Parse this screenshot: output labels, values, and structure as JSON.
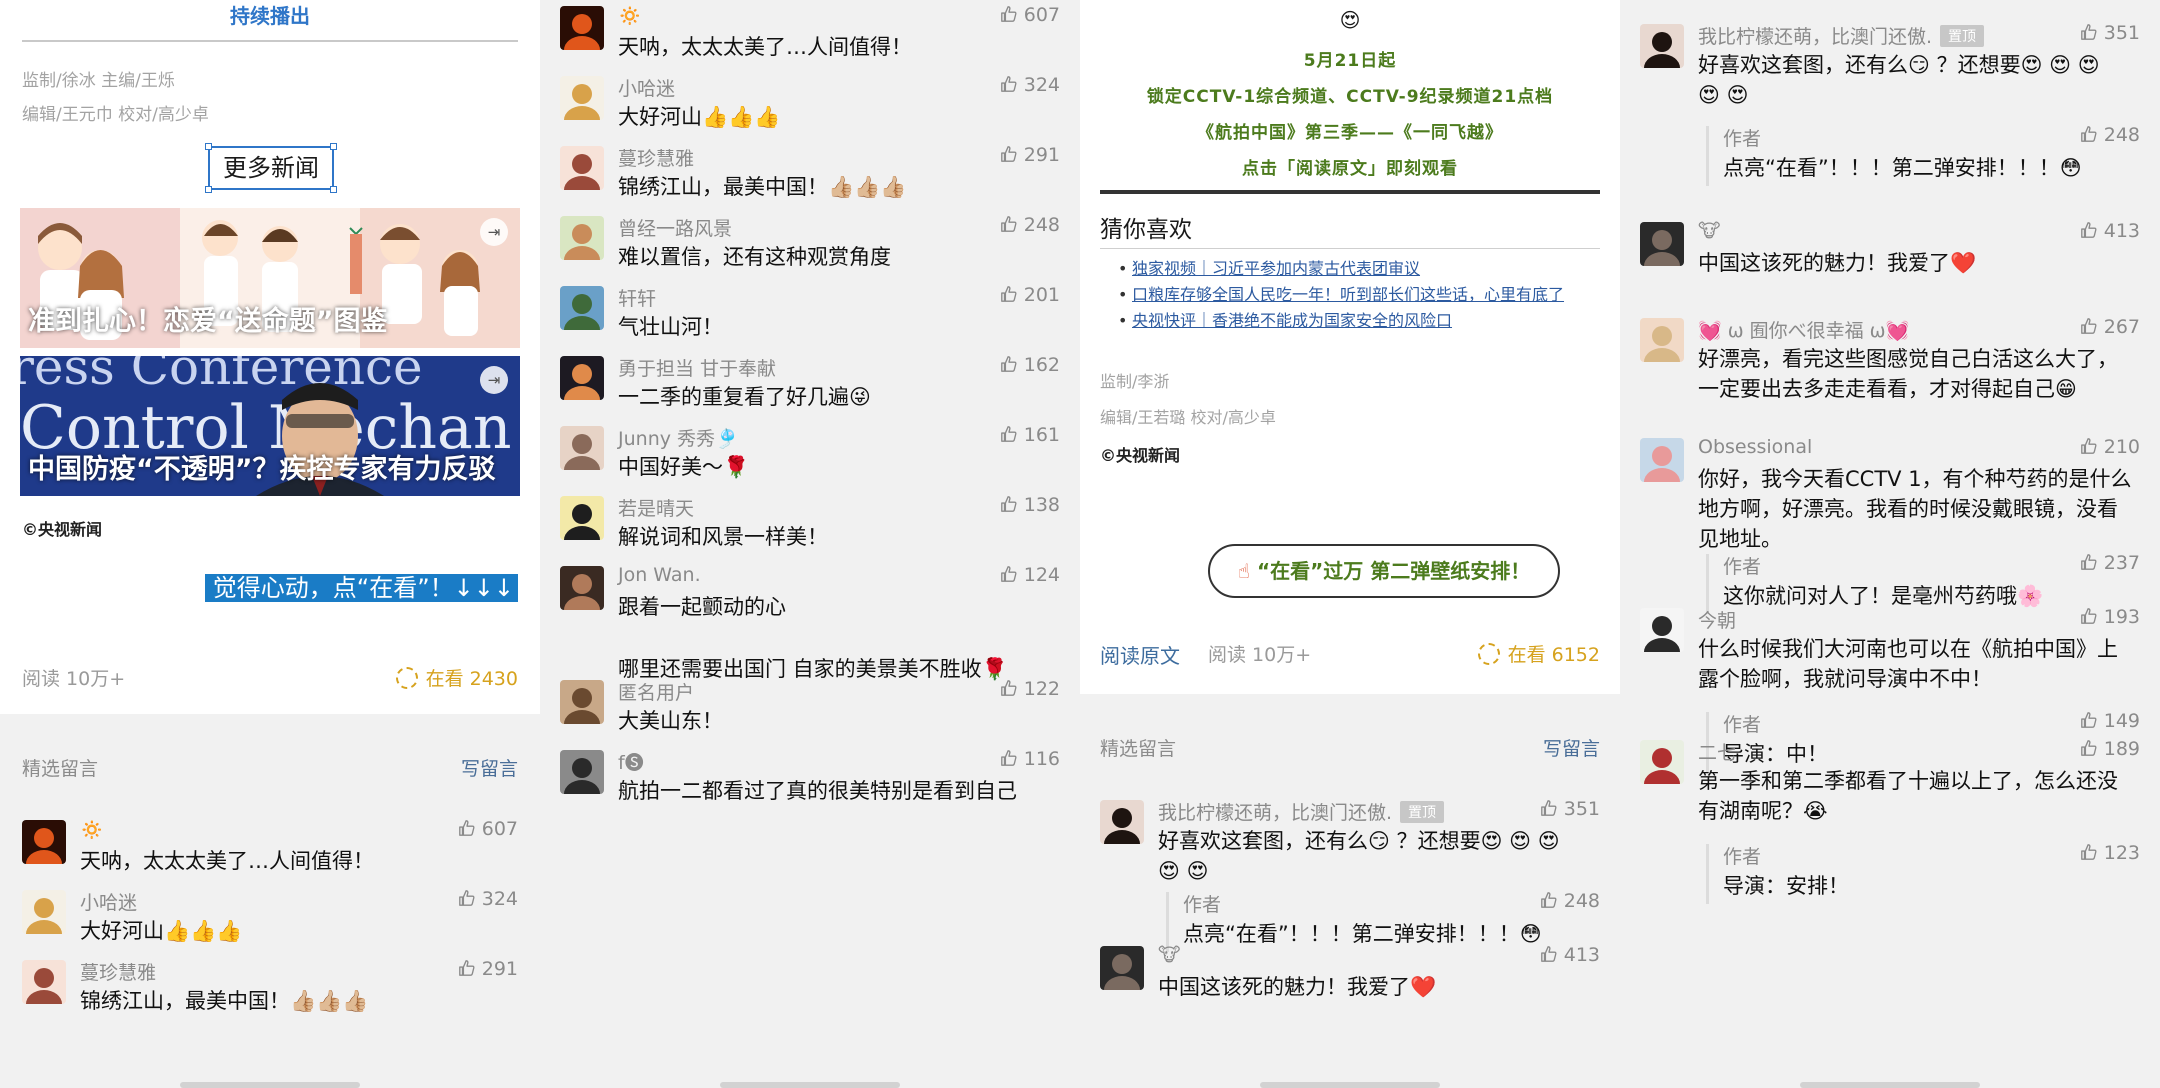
{
  "panel1": {
    "continue_title": "持续播出",
    "credits": [
      "监制/徐冰  主编/王烁",
      "编辑/王元巾 校对/高少卓"
    ],
    "more_news": "更多新闻",
    "thumb1_caption": "准到扎心！恋爱“送命题”图鉴",
    "thumb2_caption": "中国防疫“不透明”？疾控专家有力反驳",
    "thumb2_bg_text": "ress Conference\nControl Mechan",
    "copyright": "©央视新闻",
    "cta": "觉得心动，点“在看”！↓↓↓",
    "read_count": "阅读 10万+",
    "wow_count": "在看 2430",
    "section_title": "精选留言",
    "write_comment": "写留言",
    "comments": [
      {
        "nick": "🔅",
        "body": "天呐，太太太美了…人间值得！",
        "likes": "607",
        "avatar": "avatar-fire"
      },
      {
        "nick": "小哈迷",
        "body": "大好河山👍👍👍",
        "likes": "324",
        "avatar": "avatar-cartoon"
      },
      {
        "nick": "蔓珍慧雅",
        "body": "锦绣江山，最美中国！👍🏼👍🏼👍🏼",
        "likes": "291",
        "avatar": "avatar-girl"
      }
    ]
  },
  "panel2": {
    "comments": [
      {
        "nick": "🔅",
        "body": "天呐，太太太美了…人间值得！",
        "likes": "607",
        "avatar": "avatar-fire"
      },
      {
        "nick": "小哈迷",
        "body": "大好河山👍👍👍",
        "likes": "324",
        "avatar": "avatar-cartoon"
      },
      {
        "nick": "蔓珍慧雅",
        "body": "锦绣江山，最美中国！👍🏼👍🏼👍🏼",
        "likes": "291",
        "avatar": "avatar-girl"
      },
      {
        "nick": "曾经一路风景",
        "body": "难以置信，还有这种观赏角度",
        "likes": "248",
        "avatar": "avatar-man"
      },
      {
        "nick": "轩轩",
        "body": "气壮山河！",
        "likes": "201",
        "avatar": "avatar-landscape"
      },
      {
        "nick": "勇于担当 甘于奉献",
        "body": "一二季的重复看了好几遍😜",
        "likes": "162",
        "avatar": "avatar-sunset"
      },
      {
        "nick": "Junny 秀秀🎐",
        "body": "中国好美～🌹",
        "likes": "161",
        "avatar": "avatar-woman"
      },
      {
        "nick": "若是晴天",
        "body": "解说词和风景一样美！",
        "likes": "138",
        "avatar": "avatar-maruko"
      },
      {
        "nick": "Jon Wan.",
        "body": "跟着一起颤动的心",
        "body2": "哪里还需要出国门 自家的美景美不胜收🌹",
        "likes": "124",
        "avatar": "avatar-dark"
      },
      {
        "nick": "匿名用户",
        "body": "大美山东！",
        "likes": "122",
        "avatar": "avatar-bear"
      },
      {
        "nick": "f🅢",
        "body": "航拍一二都看过了真的很美特别是看到自己",
        "likes": "116",
        "avatar": "avatar-bw"
      }
    ]
  },
  "panel3": {
    "emoji": "😍",
    "lines": [
      "5月21日起",
      "锁定CCTV-1综合频道、CCTV-9纪录频道21点档",
      "《航拍中国》第三季——《一同飞越》",
      "点击「阅读原文」即刻观看"
    ],
    "guess_title": "猜你喜欢",
    "links": [
      "独家视频｜习近平参加内蒙古代表团审议",
      "口粮库存够全国人民吃一年！听到部长们这些话，心里有底了",
      "央视快评｜香港绝不能成为国家安全的风险口"
    ],
    "credits": [
      "监制/李浙",
      "编辑/王若璐 校对/高少卓"
    ],
    "copyright": "©央视新闻",
    "pill": "“在看”过万 第二弹壁纸安排！",
    "read_original": "阅读原文",
    "read_count": "阅读 10万+",
    "wow_count": "在看 6152",
    "section_title": "精选留言",
    "write_comment": "写留言",
    "comments": [
      {
        "nick": "我比柠檬还萌，比澳门还傲.",
        "pinned": "置顶",
        "body": "好喜欢这套图，还有么😏 ？还想要😍 😍 😍",
        "body2": "😍 😍",
        "likes": "351",
        "avatar": "avatar-longhair",
        "reply": {
          "name": "作者",
          "body": "点亮“在看”！！！第二弹安排！！！😳",
          "likes": "248"
        }
      },
      {
        "nick": "🐮",
        "body": "中国这该死的魅力！我爱了❤️",
        "likes": "413",
        "avatar": "avatar-dark2"
      }
    ]
  },
  "panel4": {
    "comments": [
      {
        "nick": "我比柠檬还萌，比澳门还傲.",
        "pinned": "置顶",
        "body": "好喜欢这套图，还有么😏 ？还想要😍 😍 😍",
        "body2": "😍 😍",
        "likes": "351",
        "avatar": "avatar-longhair",
        "reply": {
          "name": "作者",
          "body": "点亮“在看”！！！第二弹安排！！！😳",
          "likes": "248"
        }
      },
      {
        "nick": "🐮",
        "body": "中国这该死的魅力！我爱了❤️",
        "likes": "413",
        "avatar": "avatar-dark2"
      },
      {
        "nick": "💓 ω 囿你べ很幸福 ω💓",
        "body": "好漂亮，看完这些图感觉自己白活这么大了，一定要出去多走走看看，才对得起自己😁",
        "likes": "267",
        "avatar": "avatar-blond"
      },
      {
        "nick": "Obsessional",
        "body": "你好，我今天看CCTV 1，有个种芍药的是什么地方啊，好漂亮。我看的时候没戴眼镜，没看见地址。",
        "likes": "210",
        "avatar": "avatar-flowers",
        "reply": {
          "name": "作者",
          "body": "这你就问对人了！是亳州芍药哦🌸",
          "likes": "237"
        }
      },
      {
        "nick": "今朝",
        "body": "什么时候我们大河南也可以在《航拍中国》上露个脸啊，我就问导演中不中！",
        "likes": "193",
        "avatar": "avatar-anime",
        "reply": {
          "name": "作者",
          "body": "导演：中！",
          "likes": "149"
        }
      },
      {
        "nick": "二七",
        "body": "第一季和第二季都看了十遍以上了，怎么还没有湖南呢？😭",
        "likes": "189",
        "avatar": "avatar-maruko2",
        "reply": {
          "name": "作者",
          "body": "导演：安排！",
          "likes": "123"
        }
      }
    ]
  }
}
